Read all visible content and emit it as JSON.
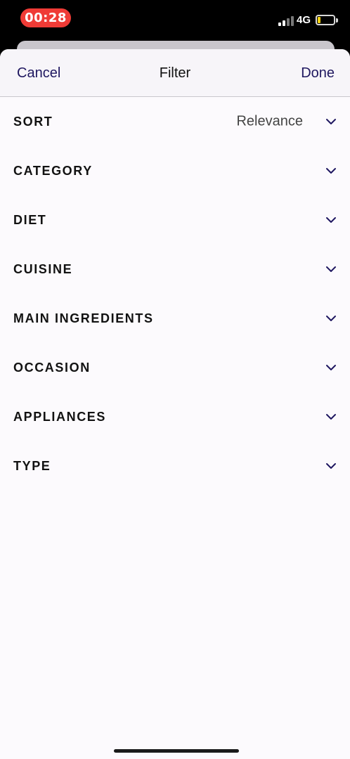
{
  "status_bar": {
    "time": "00:28",
    "network": "4G",
    "colors": {
      "recording": "#ef3b36",
      "battery": "#f5d30f"
    }
  },
  "nav": {
    "cancel_label": "Cancel",
    "title": "Filter",
    "done_label": "Done"
  },
  "filters": [
    {
      "label": "SORT",
      "value": "Relevance"
    },
    {
      "label": "CATEGORY"
    },
    {
      "label": "DIET"
    },
    {
      "label": "CUISINE"
    },
    {
      "label": "MAIN INGREDIENTS"
    },
    {
      "label": "OCCASION"
    },
    {
      "label": "APPLIANCES"
    },
    {
      "label": "TYPE"
    }
  ],
  "icons": {
    "row_expand": "chevron-down-icon"
  },
  "theme": {
    "accent": "#1f1760",
    "sheet_bg": "#fcfafd"
  }
}
